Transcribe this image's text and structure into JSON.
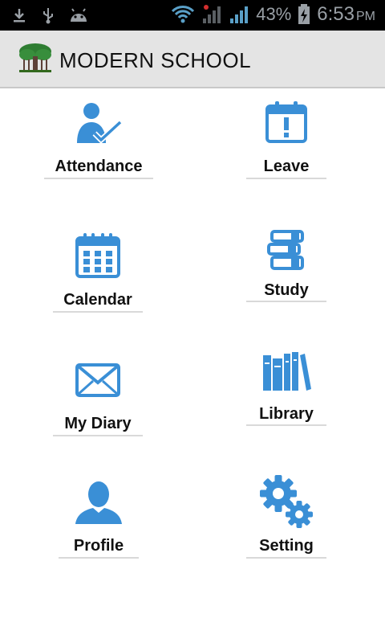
{
  "status_bar": {
    "battery_percent": "43%",
    "time": "6:53",
    "ampm": "PM"
  },
  "app_bar": {
    "title": "MODERN SCHOOL",
    "logo_icon": "tree-logo-icon"
  },
  "menu": {
    "attendance": "Attendance",
    "leave": "Leave",
    "calendar": "Calendar",
    "study": "Study",
    "my_diary": "My Diary",
    "library": "Library",
    "profile": "Profile",
    "setting": "Setting"
  },
  "colors": {
    "icon_blue": "#3a8fd6",
    "appbar_bg": "#e4e4e4",
    "logo_green": "#2e7d32"
  }
}
